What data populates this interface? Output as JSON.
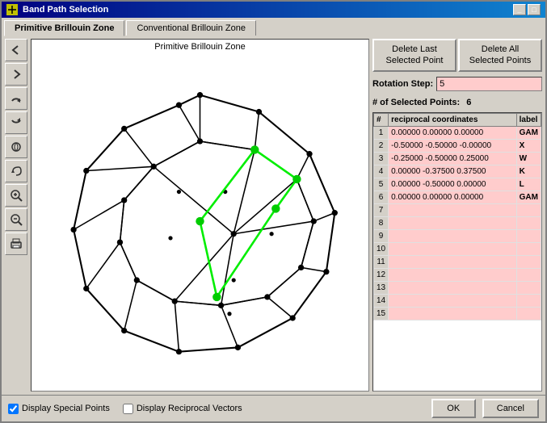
{
  "window": {
    "title": "Band Path Selection",
    "title_icon": "band-icon"
  },
  "tabs": [
    {
      "id": "primitive",
      "label": "Primitive Brillouin Zone",
      "active": true
    },
    {
      "id": "conventional",
      "label": "Conventional Brillouin Zone",
      "active": false
    }
  ],
  "canvas": {
    "label": "Primitive Brillouin Zone"
  },
  "toolbar": {
    "tools": [
      {
        "name": "arrow-left-icon",
        "glyph": "↩"
      },
      {
        "name": "arrow-right-icon",
        "glyph": "↪"
      },
      {
        "name": "rotate-ccw-icon",
        "glyph": "↺"
      },
      {
        "name": "rotate-cw-icon",
        "glyph": "↻"
      },
      {
        "name": "rotate-3d-icon",
        "glyph": "⟳"
      },
      {
        "name": "undo-icon",
        "glyph": "↶"
      },
      {
        "name": "zoom-in-icon",
        "glyph": "🔍"
      },
      {
        "name": "zoom-out-icon",
        "glyph": "🔍"
      },
      {
        "name": "print-icon",
        "glyph": "🖨"
      }
    ]
  },
  "buttons": {
    "delete_last": "Delete Last\nSelected Point",
    "delete_all": "Delete All\nSelected Points"
  },
  "fields": {
    "rotation_step_label": "Rotation Step:",
    "rotation_step_value": "5",
    "selected_points_label": "# of Selected Points:",
    "selected_points_value": "6"
  },
  "table": {
    "headers": [
      "#",
      "reciprocal coordinates",
      "label"
    ],
    "rows": [
      {
        "num": "1",
        "coords": "0.00000  0.00000  0.00000",
        "label": "GAM"
      },
      {
        "num": "2",
        "coords": "-0.50000 -0.50000 -0.00000",
        "label": "X"
      },
      {
        "num": "3",
        "coords": "-0.25000 -0.50000  0.25000",
        "label": "W"
      },
      {
        "num": "4",
        "coords": "0.00000 -0.37500  0.37500",
        "label": "K"
      },
      {
        "num": "5",
        "coords": "0.00000 -0.50000  0.00000",
        "label": "L"
      },
      {
        "num": "6",
        "coords": "0.00000  0.00000  0.00000",
        "label": "GAM"
      },
      {
        "num": "7",
        "coords": "",
        "label": ""
      },
      {
        "num": "8",
        "coords": "",
        "label": ""
      },
      {
        "num": "9",
        "coords": "",
        "label": ""
      },
      {
        "num": "10",
        "coords": "",
        "label": ""
      },
      {
        "num": "11",
        "coords": "",
        "label": ""
      },
      {
        "num": "12",
        "coords": "",
        "label": ""
      },
      {
        "num": "13",
        "coords": "",
        "label": ""
      },
      {
        "num": "14",
        "coords": "",
        "label": ""
      },
      {
        "num": "15",
        "coords": "",
        "label": ""
      }
    ]
  },
  "bottom": {
    "checkbox1_label": "Display Special Points",
    "checkbox2_label": "Display Reciprocal Vectors",
    "ok_label": "OK",
    "cancel_label": "Cancel"
  },
  "colors": {
    "accent": "#ffcccc",
    "bg": "#d4d0c8",
    "path_color": "#00ee00",
    "point_color": "#00cc00"
  }
}
